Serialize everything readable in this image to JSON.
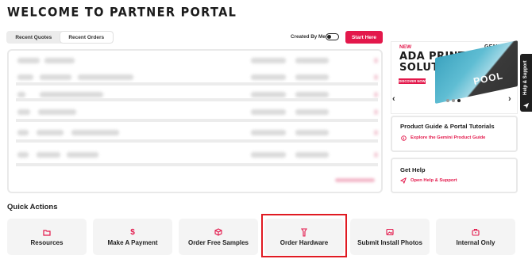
{
  "page": {
    "title": "WELCOME TO PARTNER PORTAL"
  },
  "tabs": [
    {
      "label": "Recent Quotes",
      "active": false
    },
    {
      "label": "Recent Orders",
      "active": true
    }
  ],
  "toolbar": {
    "created_by_label": "Created By Me",
    "created_by_on": false,
    "start_label": "Start Here"
  },
  "promo": {
    "badge": "NEW",
    "brand": "GEMINI",
    "title_line1": "ADA PRINT",
    "title_line2": "SOLUTION",
    "cta": "DISCOVER NOW",
    "sign_text": "POOL",
    "slides": 3,
    "active_slide": 3
  },
  "guide_card": {
    "title": "Product Guide & Portal Tutorials",
    "link": "Explore the Gemini Product Guide"
  },
  "help_card": {
    "title": "Get Help",
    "link": "Open Help & Support"
  },
  "help_tab": {
    "label": "Help & Support"
  },
  "quick_actions": {
    "title": "Quick Actions",
    "items": [
      {
        "label": "Resources",
        "icon": "folder-icon"
      },
      {
        "label": "Make A Payment",
        "icon": "dollar-icon"
      },
      {
        "label": "Order Free Samples",
        "icon": "box-icon"
      },
      {
        "label": "Order Hardware",
        "icon": "hardware-icon",
        "highlighted": true
      },
      {
        "label": "Submit Install Photos",
        "icon": "image-icon"
      },
      {
        "label": "Internal Only",
        "icon": "briefcase-icon"
      }
    ]
  },
  "colors": {
    "accent": "#e3184b",
    "highlight_border": "#e01a22",
    "dark": "#1b1b1b"
  }
}
